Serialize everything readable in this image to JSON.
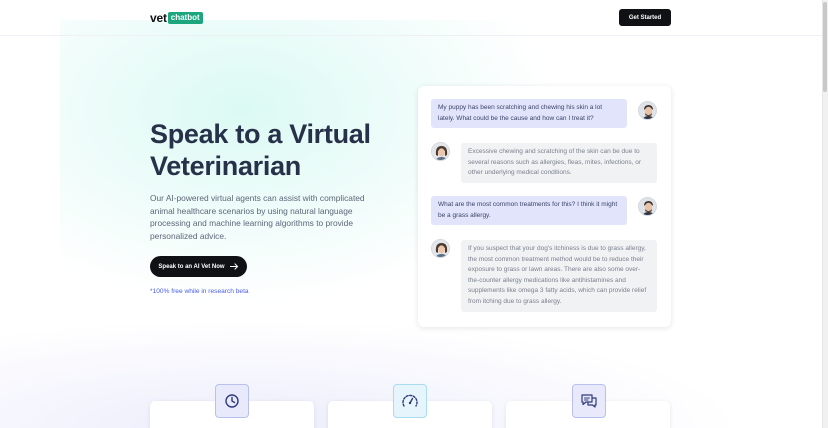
{
  "brand": {
    "name": "vet",
    "badge": "chatbot",
    "accent_color": "#1ba67e"
  },
  "header": {
    "cta_label": "Get Started"
  },
  "hero": {
    "title": "Speak to a Virtual Veterinarian",
    "description": "Our AI-powered virtual agents can assist with complicated animal healthcare scenarios by using natural language processing and machine learning algorithms to provide personalized advice.",
    "cta_label": "Speak to an AI Vet Now",
    "cta_icon": "arrow-right-icon",
    "note": "*100% free while in research beta"
  },
  "chat": {
    "messages": [
      {
        "role": "user",
        "text": "My puppy has been scratching and chewing his skin a lot lately. What could be the cause and how can I treat it?"
      },
      {
        "role": "bot",
        "text": "Excessive chewing and scratching of the skin can be due to several reasons such as allergies, fleas, mites, infections, or other underlying medical conditions."
      },
      {
        "role": "user",
        "text": "What are the most common treatments for this? I think it might be a grass allergy."
      },
      {
        "role": "bot",
        "text": "If you suspect that your dog's itchiness is due to grass allergy, the most common treatment method would be to reduce their exposure to grass or lawn areas. There are also some over-the-counter allergy medications like antihistamines and supplements like omega 3 fatty acids, which can provide relief from itching due to grass allergy."
      }
    ]
  },
  "features": [
    {
      "icon": "clock-icon"
    },
    {
      "icon": "speedometer-icon"
    },
    {
      "icon": "chat-bubbles-icon"
    }
  ],
  "colors": {
    "user_bubble": "#e2e4fb",
    "bot_bubble": "#f1f2f4",
    "dark_button": "#0f1115",
    "link_blue": "#4a5ee8"
  }
}
